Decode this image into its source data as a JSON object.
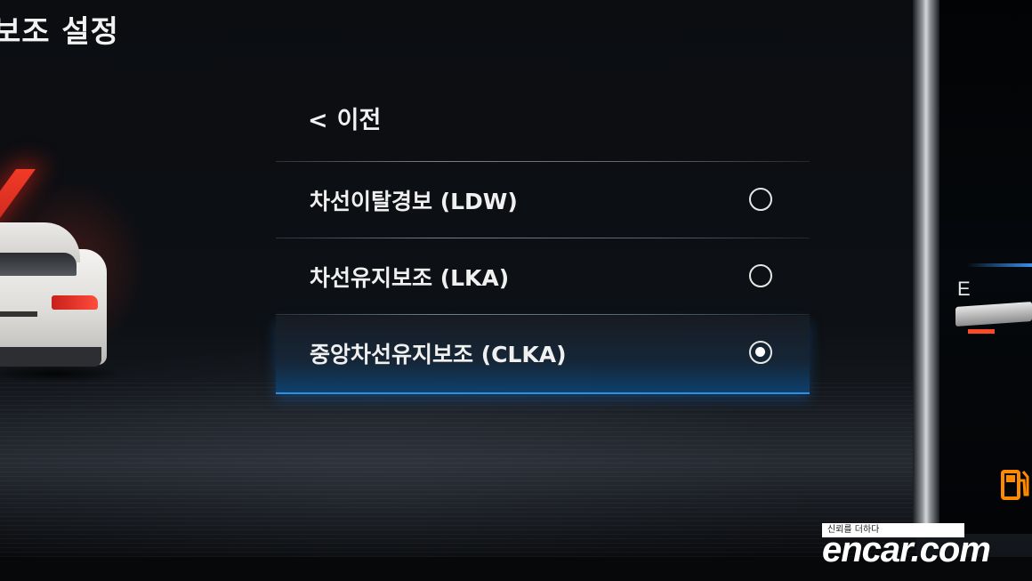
{
  "header": {
    "title": "보조 설정"
  },
  "nav": {
    "back_chevron": "<",
    "back_label": "이전"
  },
  "options": [
    {
      "label": "차선이탈경보 (LDW)",
      "selected": false
    },
    {
      "label": "차선유지보조 (LKA)",
      "selected": false
    },
    {
      "label": "중앙차선유지보조 (CLKA)",
      "selected": true
    }
  ],
  "cluster": {
    "fuel_empty_label": "E",
    "fuel_icon": "fuel-pump-icon",
    "fuel_icon_color": "#ff8a00"
  },
  "watermark": {
    "tagline": "신뢰를 더하다",
    "brand": "encar.com"
  },
  "colors": {
    "selection_accent": "#2e8ee0",
    "lane_warning": "#ff3c28"
  }
}
